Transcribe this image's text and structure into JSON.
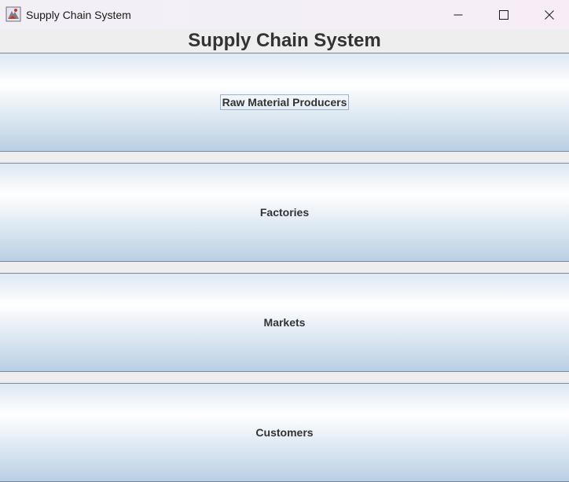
{
  "window": {
    "title": "Supply Chain System",
    "icon": "java-app-icon"
  },
  "header": {
    "title": "Supply Chain System"
  },
  "buttons": [
    {
      "label": "Raw Material Producers",
      "focused": true
    },
    {
      "label": "Factories",
      "focused": false
    },
    {
      "label": "Markets",
      "focused": false
    },
    {
      "label": "Customers",
      "focused": false
    }
  ],
  "colors": {
    "button_gradient_top": "#dde8f3",
    "button_gradient_mid": "#ffffff",
    "button_gradient_bottom": "#b9cfe3",
    "button_border": "#7a8a9c",
    "text": "#333333",
    "background": "#eeeeee"
  }
}
